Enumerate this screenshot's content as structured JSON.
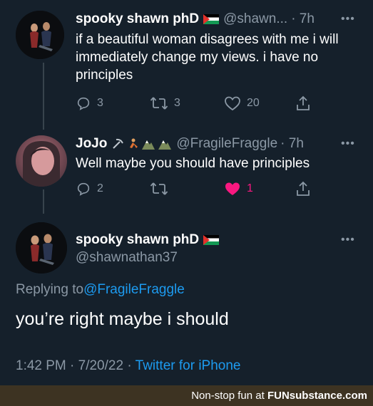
{
  "tweets": [
    {
      "name": "spooky shawn phD",
      "handle": "@shawn...",
      "time": "· 7h",
      "text": "if a beautiful woman disagrees with me i will immediately change my views. i have no principles",
      "replies": "3",
      "retweets": "3",
      "likes": "20"
    },
    {
      "name": "JoJo",
      "handle": "@FragileFraggle",
      "time": "· 7h",
      "text": "Well maybe you should have principles",
      "replies": "2",
      "retweets": "",
      "likes": "1"
    }
  ],
  "main_tweet": {
    "name": "spooky shawn phD",
    "handle": "@shawnathan37",
    "replying_prefix": "Replying to ",
    "replying_to": "@FragileFraggle",
    "text": "you’re right maybe i should",
    "timestamp": "1:42 PM · 7/20/22 · ",
    "source": "Twitter for iPhone"
  },
  "watermark": {
    "prefix": "Non-stop fun at ",
    "brand": "FUNsubstance.com"
  },
  "colors": {
    "background": "#15202b",
    "secondary_text": "#8b98a5",
    "link": "#1d9bf0",
    "like_active": "#f91880"
  }
}
